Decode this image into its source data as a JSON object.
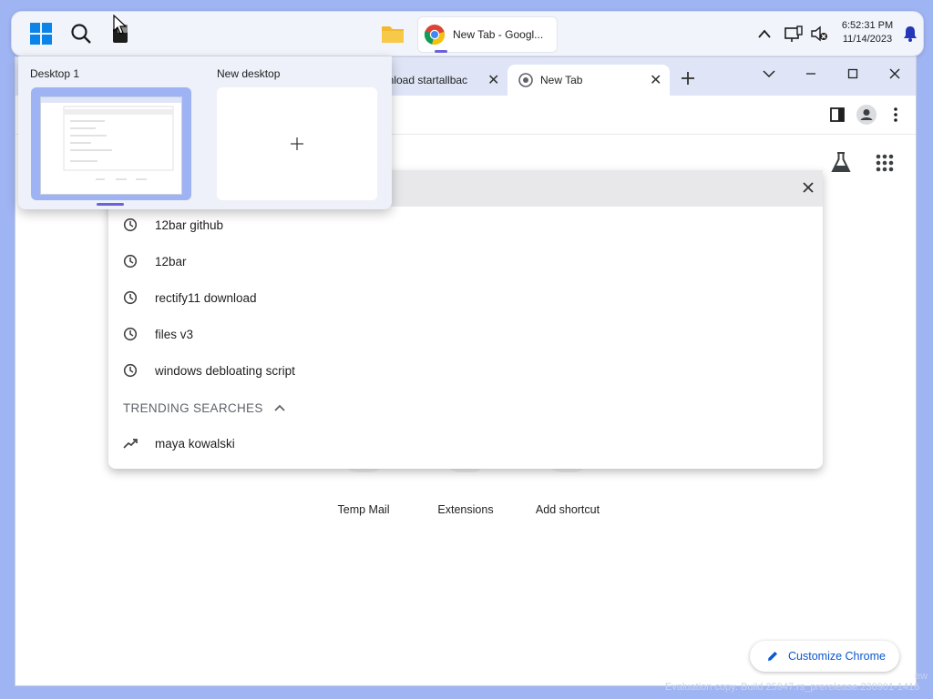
{
  "taskbar": {
    "chrome_button_title": "New Tab - Googl...",
    "clock_time": "6:52:31 PM",
    "clock_date": "11/14/2023"
  },
  "taskview": {
    "desktop1_label": "Desktop 1",
    "new_desktop_label": "New desktop"
  },
  "tabs": {
    "inactive_title": "wnload startallbac",
    "active_title": "New Tab"
  },
  "omnibox": {
    "suggestions": [
      {
        "text": "12bar github",
        "icon": "history-icon"
      },
      {
        "text": "12bar",
        "icon": "history-icon"
      },
      {
        "text": "rectify11 download",
        "icon": "history-icon"
      },
      {
        "text": "files v3",
        "icon": "history-icon"
      },
      {
        "text": "windows debloating script",
        "icon": "history-icon"
      }
    ],
    "trending_header": "TRENDING SEARCHES",
    "trending": [
      {
        "text": "maya kowalski",
        "icon": "trending-up-icon"
      }
    ]
  },
  "shortcuts": [
    {
      "label": "Temp Mail"
    },
    {
      "label": "Extensions"
    },
    {
      "label": "Add shortcut"
    }
  ],
  "customize_label": "Customize Chrome",
  "watermark": "Evaluation copy. Build 25947.rs_prerelease.230901-1416",
  "watermark_right": "ew",
  "colors": {
    "accent": "#6b62d8",
    "link_blue": "#0b57d0",
    "desktop_bg": "#9fb4f2"
  }
}
